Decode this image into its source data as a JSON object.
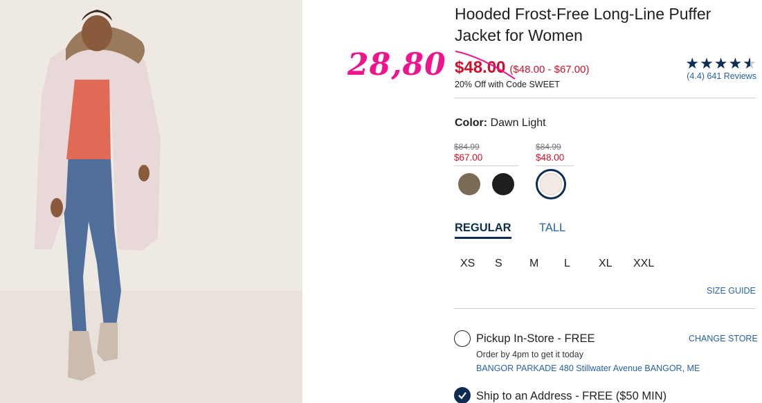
{
  "product": {
    "title": "Hooded Frost-Free Long-Line Puffer Jacket for Women",
    "price": "$48.00",
    "price_range": "($48.00 - $67.00)",
    "promo": "20% Off with Code SWEET",
    "handwritten_price": "28,80"
  },
  "rating": {
    "value": 4.4,
    "stars_full": 4,
    "reviews_text": "(4.4) 641 Reviews"
  },
  "color": {
    "label": "Color:",
    "selected": "Dawn Light",
    "groups": [
      {
        "old_price": "$84.99",
        "new_price": "$67.00"
      },
      {
        "old_price": "$84.99",
        "new_price": "$48.00"
      }
    ],
    "swatches": [
      {
        "name": "olive",
        "color": "#7a6b54"
      },
      {
        "name": "black",
        "color": "#1e1e1e"
      },
      {
        "name": "dawn-light",
        "color": "#f4ebe6",
        "selected": true
      }
    ]
  },
  "fit_tabs": [
    {
      "label": "REGULAR",
      "active": true
    },
    {
      "label": "TALL",
      "active": false
    }
  ],
  "sizes": [
    "XS",
    "S",
    "M",
    "L",
    "XL",
    "XXL"
  ],
  "size_guide": "SIZE GUIDE",
  "fulfillment": {
    "pickup": {
      "title": "Pickup In-Store - FREE",
      "subtitle": "Order by 4pm to get it today",
      "store": "BANGOR PARKADE 480 Stillwater Avenue  BANGOR, ME",
      "change": "CHANGE STORE"
    },
    "ship": {
      "title": "Ship to an Address - FREE ($50 MIN)"
    }
  },
  "colors": {
    "sale_red": "#d0102a",
    "navy": "#0d2c54",
    "link_blue": "#2662a8",
    "annotation_pink": "#f0148c"
  }
}
